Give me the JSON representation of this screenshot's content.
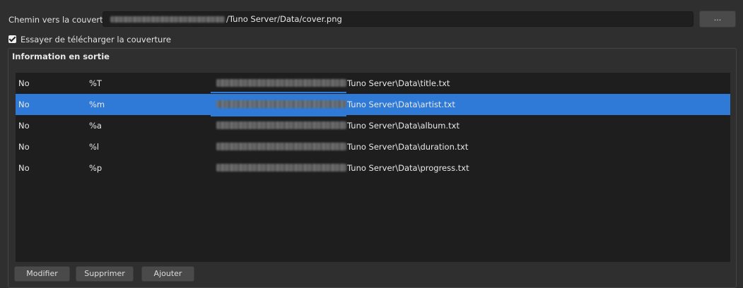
{
  "cover": {
    "label": "Chemin vers la couverture",
    "path_value": "/Tuno Server/Data/cover.png",
    "browse_label": "..."
  },
  "download_option": {
    "label": "Essayer de télécharger la couverture",
    "checked": true
  },
  "output_group": {
    "title": "Information en sortie",
    "rows": [
      {
        "col1": "No",
        "col2": "%T",
        "path": "Tuno Server\\Data\\title.txt",
        "selected": false
      },
      {
        "col1": "No",
        "col2": "%m",
        "path": "Tuno Server\\Data\\artist.txt",
        "selected": true
      },
      {
        "col1": "No",
        "col2": "%a",
        "path": "Tuno Server\\Data\\album.txt",
        "selected": false
      },
      {
        "col1": "No",
        "col2": "%l",
        "path": "Tuno Server\\Data\\duration.txt",
        "selected": false
      },
      {
        "col1": "No",
        "col2": "%p",
        "path": "Tuno Server\\Data\\progress.txt",
        "selected": false
      }
    ]
  },
  "buttons": {
    "modify": "Modifier",
    "delete": "Supprimer",
    "add": "Ajouter"
  },
  "colors": {
    "selection": "#2f7ad6",
    "background": "#2f2f2f",
    "table_background": "#1e1e1e"
  }
}
